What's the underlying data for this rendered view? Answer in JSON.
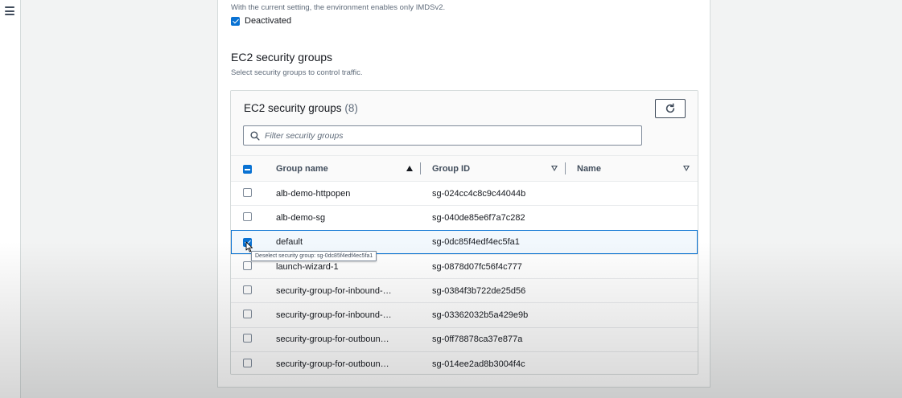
{
  "menu_icon": "hamburger-icon",
  "imds": {
    "note": "With the current setting, the environment enables only IMDSv2.",
    "checkbox_label": "Deactivated",
    "checked": true
  },
  "section": {
    "title": "EC2 security groups",
    "description": "Select security groups to control traffic."
  },
  "table": {
    "title": "EC2 security groups",
    "count": "(8)",
    "refresh_icon": "refresh-icon",
    "filter_placeholder": "Filter security groups",
    "columns": {
      "group_name": "Group name",
      "group_id": "Group ID",
      "name": "Name"
    },
    "header_checkbox_state": "indeterminate",
    "rows": [
      {
        "group_name": "alb-demo-httpopen",
        "group_id": "sg-024cc4c8c9c44044b",
        "name": "",
        "selected": false
      },
      {
        "group_name": "alb-demo-sg",
        "group_id": "sg-040de85e6f7a7c282",
        "name": "",
        "selected": false
      },
      {
        "group_name": "default",
        "group_id": "sg-0dc85f4edf4ec5fa1",
        "name": "",
        "selected": true
      },
      {
        "group_name": "launch-wizard-1",
        "group_id": "sg-0878d07fc56f4c777",
        "name": "",
        "selected": false
      },
      {
        "group_name": "security-group-for-inbound-…",
        "group_id": "sg-0384f3b722de25d56",
        "name": "",
        "selected": false
      },
      {
        "group_name": "security-group-for-inbound-…",
        "group_id": "sg-03362032b5a429e9b",
        "name": "",
        "selected": false
      },
      {
        "group_name": "security-group-for-outboun…",
        "group_id": "sg-0ff78878ca37e877a",
        "name": "",
        "selected": false
      },
      {
        "group_name": "security-group-for-outboun…",
        "group_id": "sg-014ee2ad8b3004f4c",
        "name": "",
        "selected": false
      }
    ]
  },
  "tooltip": "Deselect security group: sg-0dc85f4edf4ec5fa1",
  "colors": {
    "accent": "#0972d3",
    "selected_row_bg": "#f2f8fd"
  }
}
